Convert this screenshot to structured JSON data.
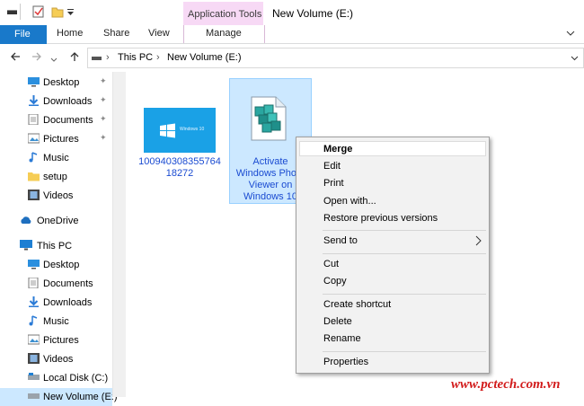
{
  "title_bar": {
    "context_tab_group": "Application Tools",
    "window_title": "New Volume (E:)"
  },
  "ribbon": {
    "tabs": [
      "File",
      "Home",
      "Share",
      "View",
      "Manage"
    ]
  },
  "address_bar": {
    "crumbs": [
      "This PC",
      "New Volume (E:)"
    ]
  },
  "nav_pane": {
    "quick_access": [
      {
        "label": "Desktop",
        "icon": "desktop-icon",
        "pinned": true
      },
      {
        "label": "Downloads",
        "icon": "download-icon",
        "pinned": true
      },
      {
        "label": "Documents",
        "icon": "documents-icon",
        "pinned": true
      },
      {
        "label": "Pictures",
        "icon": "pictures-icon",
        "pinned": true
      },
      {
        "label": "Music",
        "icon": "music-icon",
        "pinned": false
      },
      {
        "label": "setup",
        "icon": "folder-icon",
        "pinned": false
      },
      {
        "label": "Videos",
        "icon": "videos-icon",
        "pinned": false
      }
    ],
    "onedrive": "OneDrive",
    "this_pc": "This PC",
    "this_pc_items": [
      {
        "label": "Desktop",
        "icon": "desktop-icon"
      },
      {
        "label": "Documents",
        "icon": "documents-icon"
      },
      {
        "label": "Downloads",
        "icon": "download-icon"
      },
      {
        "label": "Music",
        "icon": "music-icon"
      },
      {
        "label": "Pictures",
        "icon": "pictures-icon"
      },
      {
        "label": "Videos",
        "icon": "videos-icon"
      },
      {
        "label": "Local Disk (C:)",
        "icon": "disk-icon"
      },
      {
        "label": "New Volume (E:)",
        "icon": "disk-icon"
      }
    ]
  },
  "files": [
    {
      "name": "100940308355764 18272",
      "thumb_text": "Windows 10"
    },
    {
      "name": "Activate Windows Photo Viewer on Windows 10",
      "selected": true
    }
  ],
  "context_menu": {
    "items": [
      "Merge",
      "Edit",
      "Print",
      "Open with...",
      "Restore previous versions",
      "Send to",
      "Cut",
      "Copy",
      "Create shortcut",
      "Delete",
      "Rename",
      "Properties"
    ]
  },
  "watermark": "www.pctech.com.vn",
  "colors": {
    "accent": "#1979ca",
    "context_tab": "#f7d9f5",
    "selection": "#cce8ff",
    "link_text": "#1a4bd1",
    "watermark": "#d21b1b"
  }
}
